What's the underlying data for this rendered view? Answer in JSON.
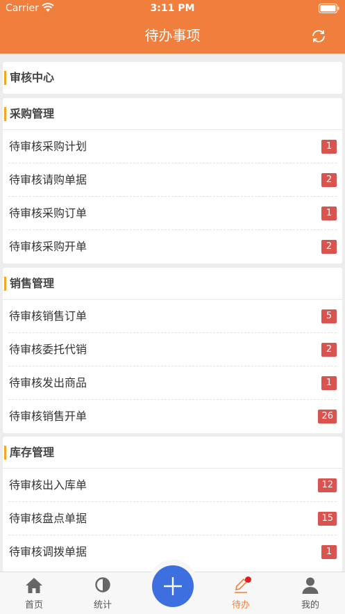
{
  "status_bar": {
    "carrier": "Carrier",
    "time": "3:11 PM"
  },
  "nav": {
    "title": "待办事项",
    "refresh_icon": "refresh-icon"
  },
  "audit_center": {
    "title": "审核中心"
  },
  "sections": [
    {
      "title": "采购管理",
      "items": [
        {
          "label": "待审核采购计划",
          "count": "1"
        },
        {
          "label": "待审核请购单据",
          "count": "2"
        },
        {
          "label": "待审核采购订单",
          "count": "1"
        },
        {
          "label": "待审核采购开单",
          "count": "2"
        }
      ]
    },
    {
      "title": "销售管理",
      "items": [
        {
          "label": "待审核销售订单",
          "count": "5"
        },
        {
          "label": "待审核委托代销",
          "count": "2"
        },
        {
          "label": "待审核发出商品",
          "count": "1"
        },
        {
          "label": "待审核销售开单",
          "count": "26"
        }
      ]
    },
    {
      "title": "库存管理",
      "items": [
        {
          "label": "待审核出入库单",
          "count": "12"
        },
        {
          "label": "待审核盘点单据",
          "count": "15"
        },
        {
          "label": "待审核调拨单据",
          "count": "1"
        }
      ]
    }
  ],
  "tabbar": {
    "home": "首页",
    "stats": "统计",
    "todo": "待办",
    "mine": "我的"
  },
  "colors": {
    "accent": "#f07f3e",
    "badge": "#d9534f",
    "fab": "#3d6fe0",
    "section_bar": "#f5a623"
  }
}
